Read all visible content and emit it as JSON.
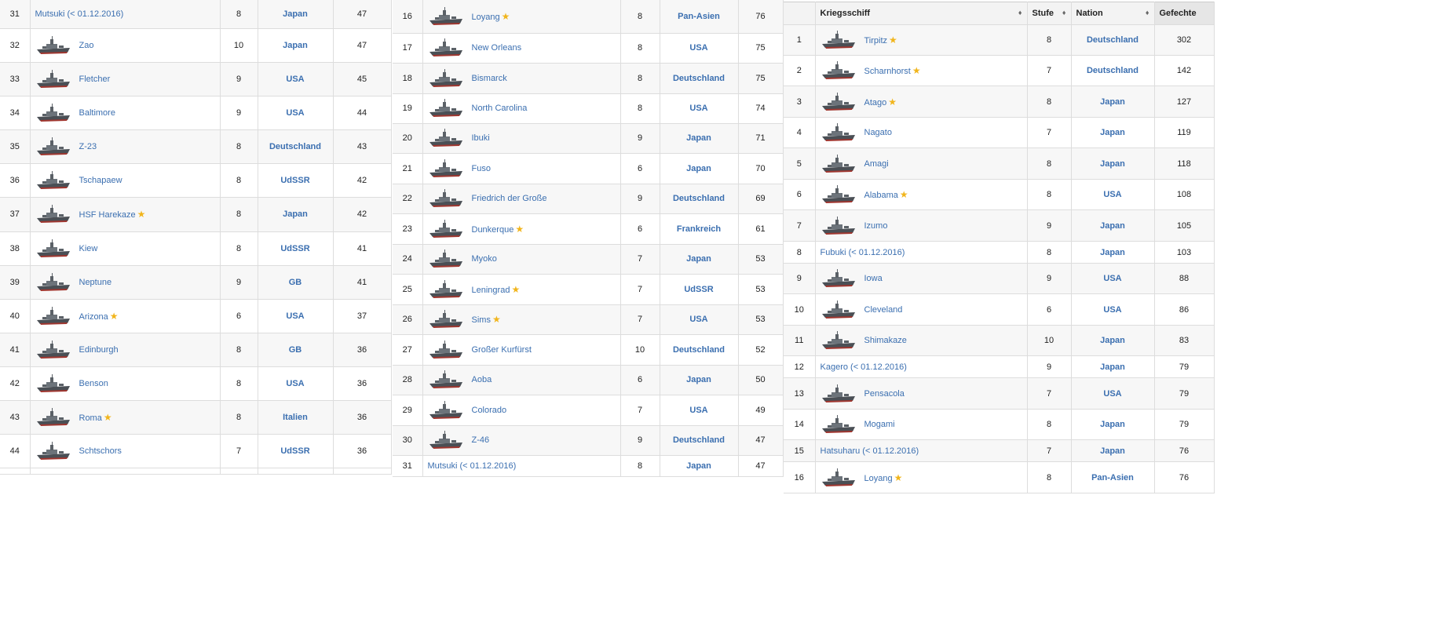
{
  "header": {
    "col_ship": "Kriegsschiff",
    "col_tier": "Stufe",
    "col_nation": "Nation",
    "col_battles": "Gefechte",
    "sort_icon": "♦"
  },
  "panels": [
    {
      "rows": [
        {
          "rank": "31",
          "ship": "Mutsuki (< 01.12.2016)",
          "icon": false,
          "premium": false,
          "tier": "8",
          "nation": "Japan",
          "battles": "47"
        },
        {
          "rank": "32",
          "ship": "Zao",
          "icon": true,
          "premium": false,
          "tier": "10",
          "nation": "Japan",
          "battles": "47"
        },
        {
          "rank": "33",
          "ship": "Fletcher",
          "icon": true,
          "premium": false,
          "tier": "9",
          "nation": "USA",
          "battles": "45"
        },
        {
          "rank": "34",
          "ship": "Baltimore",
          "icon": true,
          "premium": false,
          "tier": "9",
          "nation": "USA",
          "battles": "44"
        },
        {
          "rank": "35",
          "ship": "Z-23",
          "icon": true,
          "premium": false,
          "tier": "8",
          "nation": "Deutschland",
          "battles": "43"
        },
        {
          "rank": "36",
          "ship": "Tschapaew",
          "icon": true,
          "premium": false,
          "tier": "8",
          "nation": "UdSSR",
          "battles": "42"
        },
        {
          "rank": "37",
          "ship": "HSF Harekaze",
          "icon": true,
          "premium": true,
          "tier": "8",
          "nation": "Japan",
          "battles": "42"
        },
        {
          "rank": "38",
          "ship": "Kiew",
          "icon": true,
          "premium": false,
          "tier": "8",
          "nation": "UdSSR",
          "battles": "41"
        },
        {
          "rank": "39",
          "ship": "Neptune",
          "icon": true,
          "premium": false,
          "tier": "9",
          "nation": "GB",
          "battles": "41"
        },
        {
          "rank": "40",
          "ship": "Arizona",
          "icon": true,
          "premium": true,
          "tier": "6",
          "nation": "USA",
          "battles": "37"
        },
        {
          "rank": "41",
          "ship": "Edinburgh",
          "icon": true,
          "premium": false,
          "tier": "8",
          "nation": "GB",
          "battles": "36"
        },
        {
          "rank": "42",
          "ship": "Benson",
          "icon": true,
          "premium": false,
          "tier": "8",
          "nation": "USA",
          "battles": "36"
        },
        {
          "rank": "43",
          "ship": "Roma",
          "icon": true,
          "premium": true,
          "tier": "8",
          "nation": "Italien",
          "battles": "36"
        },
        {
          "rank": "44",
          "ship": "Schtschors",
          "icon": true,
          "premium": false,
          "tier": "7",
          "nation": "UdSSR",
          "battles": "36"
        }
      ]
    },
    {
      "rows": [
        {
          "rank": "16",
          "ship": "Loyang",
          "icon": true,
          "premium": true,
          "tier": "8",
          "nation": "Pan-Asien",
          "battles": "76"
        },
        {
          "rank": "17",
          "ship": "New Orleans",
          "icon": true,
          "premium": false,
          "tier": "8",
          "nation": "USA",
          "battles": "75"
        },
        {
          "rank": "18",
          "ship": "Bismarck",
          "icon": true,
          "premium": false,
          "tier": "8",
          "nation": "Deutschland",
          "battles": "75"
        },
        {
          "rank": "19",
          "ship": "North Carolina",
          "icon": true,
          "premium": false,
          "tier": "8",
          "nation": "USA",
          "battles": "74"
        },
        {
          "rank": "20",
          "ship": "Ibuki",
          "icon": true,
          "premium": false,
          "tier": "9",
          "nation": "Japan",
          "battles": "71"
        },
        {
          "rank": "21",
          "ship": "Fuso",
          "icon": true,
          "premium": false,
          "tier": "6",
          "nation": "Japan",
          "battles": "70"
        },
        {
          "rank": "22",
          "ship": "Friedrich der Große",
          "icon": true,
          "premium": false,
          "tier": "9",
          "nation": "Deutschland",
          "battles": "69"
        },
        {
          "rank": "23",
          "ship": "Dunkerque",
          "icon": true,
          "premium": true,
          "tier": "6",
          "nation": "Frankreich",
          "battles": "61"
        },
        {
          "rank": "24",
          "ship": "Myoko",
          "icon": true,
          "premium": false,
          "tier": "7",
          "nation": "Japan",
          "battles": "53"
        },
        {
          "rank": "25",
          "ship": "Leningrad",
          "icon": true,
          "premium": true,
          "tier": "7",
          "nation": "UdSSR",
          "battles": "53"
        },
        {
          "rank": "26",
          "ship": "Sims",
          "icon": true,
          "premium": true,
          "tier": "7",
          "nation": "USA",
          "battles": "53"
        },
        {
          "rank": "27",
          "ship": "Großer Kurfürst",
          "icon": true,
          "premium": false,
          "tier": "10",
          "nation": "Deutschland",
          "battles": "52"
        },
        {
          "rank": "28",
          "ship": "Aoba",
          "icon": true,
          "premium": false,
          "tier": "6",
          "nation": "Japan",
          "battles": "50"
        },
        {
          "rank": "29",
          "ship": "Colorado",
          "icon": true,
          "premium": false,
          "tier": "7",
          "nation": "USA",
          "battles": "49"
        },
        {
          "rank": "30",
          "ship": "Z-46",
          "icon": true,
          "premium": false,
          "tier": "9",
          "nation": "Deutschland",
          "battles": "47"
        },
        {
          "rank": "31",
          "ship": "Mutsuki (< 01.12.2016)",
          "icon": false,
          "premium": false,
          "tier": "8",
          "nation": "Japan",
          "battles": "47"
        }
      ]
    },
    {
      "rows": [
        {
          "rank": "1",
          "ship": "Tirpitz",
          "icon": true,
          "premium": true,
          "tier": "8",
          "nation": "Deutschland",
          "battles": "302"
        },
        {
          "rank": "2",
          "ship": "Scharnhorst",
          "icon": true,
          "premium": true,
          "tier": "7",
          "nation": "Deutschland",
          "battles": "142"
        },
        {
          "rank": "3",
          "ship": "Atago",
          "icon": true,
          "premium": true,
          "tier": "8",
          "nation": "Japan",
          "battles": "127"
        },
        {
          "rank": "4",
          "ship": "Nagato",
          "icon": true,
          "premium": false,
          "tier": "7",
          "nation": "Japan",
          "battles": "119"
        },
        {
          "rank": "5",
          "ship": "Amagi",
          "icon": true,
          "premium": false,
          "tier": "8",
          "nation": "Japan",
          "battles": "118"
        },
        {
          "rank": "6",
          "ship": "Alabama",
          "icon": true,
          "premium": true,
          "tier": "8",
          "nation": "USA",
          "battles": "108"
        },
        {
          "rank": "7",
          "ship": "Izumo",
          "icon": true,
          "premium": false,
          "tier": "9",
          "nation": "Japan",
          "battles": "105"
        },
        {
          "rank": "8",
          "ship": "Fubuki (< 01.12.2016)",
          "icon": false,
          "premium": false,
          "tier": "8",
          "nation": "Japan",
          "battles": "103"
        },
        {
          "rank": "9",
          "ship": "Iowa",
          "icon": true,
          "premium": false,
          "tier": "9",
          "nation": "USA",
          "battles": "88"
        },
        {
          "rank": "10",
          "ship": "Cleveland",
          "icon": true,
          "premium": false,
          "tier": "6",
          "nation": "USA",
          "battles": "86"
        },
        {
          "rank": "11",
          "ship": "Shimakaze",
          "icon": true,
          "premium": false,
          "tier": "10",
          "nation": "Japan",
          "battles": "83"
        },
        {
          "rank": "12",
          "ship": "Kagero (< 01.12.2016)",
          "icon": false,
          "premium": false,
          "tier": "9",
          "nation": "Japan",
          "battles": "79"
        },
        {
          "rank": "13",
          "ship": "Pensacola",
          "icon": true,
          "premium": false,
          "tier": "7",
          "nation": "USA",
          "battles": "79"
        },
        {
          "rank": "14",
          "ship": "Mogami",
          "icon": true,
          "premium": false,
          "tier": "8",
          "nation": "Japan",
          "battles": "79"
        },
        {
          "rank": "15",
          "ship": "Hatsuharu (< 01.12.2016)",
          "icon": false,
          "premium": false,
          "tier": "7",
          "nation": "Japan",
          "battles": "76"
        },
        {
          "rank": "16",
          "ship": "Loyang",
          "icon": true,
          "premium": true,
          "tier": "8",
          "nation": "Pan-Asien",
          "battles": "76"
        }
      ]
    }
  ]
}
